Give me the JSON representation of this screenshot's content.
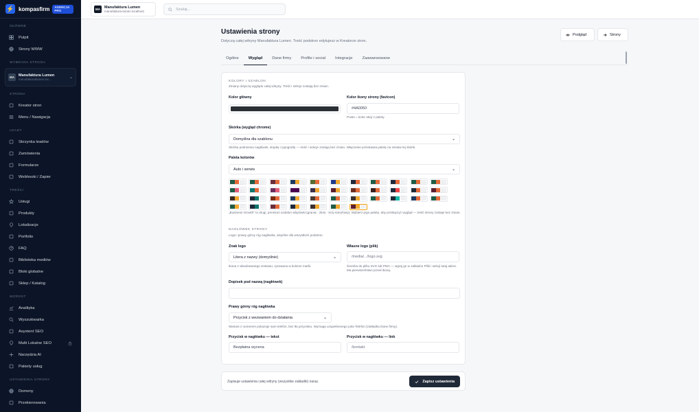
{
  "brand": {
    "name": "kompasfirm",
    "badge": "AGENCJA PRO",
    "logo_glyph": "⚡"
  },
  "sidebar": {
    "sections": [
      {
        "title": "GŁÓWNE",
        "items": [
          {
            "label": "Pulpit",
            "icon": "grid-icon"
          },
          {
            "label": "Strony WWW",
            "icon": "globe-icon"
          }
        ]
      },
      {
        "title": "WYBRANA STRONA"
      },
      {
        "title": "STRONA",
        "items": [
          {
            "label": "Kreator stron",
            "icon": "layout-icon"
          },
          {
            "label": "Menu / Nawigacja",
            "icon": "menu-icon"
          }
        ]
      },
      {
        "title": "LEADY",
        "items": [
          {
            "label": "Skrzynka leadów",
            "icon": "inbox-icon"
          },
          {
            "label": "Zamówienia",
            "icon": "cart-icon"
          },
          {
            "label": "Formularze",
            "icon": "form-icon"
          },
          {
            "label": "Webhooki / Zapier",
            "icon": "webhook-icon"
          }
        ]
      },
      {
        "title": "TREŚCI",
        "items": [
          {
            "label": "Usługi",
            "icon": "star-icon"
          },
          {
            "label": "Produkty",
            "icon": "box-icon"
          },
          {
            "label": "Lokalizacje",
            "icon": "map-pin-icon"
          },
          {
            "label": "Portfolio",
            "icon": "image-icon"
          },
          {
            "label": "FAQ",
            "icon": "help-icon"
          },
          {
            "label": "Biblioteka mediów",
            "icon": "folder-icon"
          },
          {
            "label": "Bloki globalne",
            "icon": "layers-icon"
          },
          {
            "label": "Sklep / Katalog",
            "icon": "tag-icon"
          }
        ]
      },
      {
        "title": "WZROST",
        "items": [
          {
            "label": "Analityka",
            "icon": "chart-icon"
          },
          {
            "label": "Wyszukiwarka",
            "icon": "search-icon"
          },
          {
            "label": "Asystent SEO",
            "icon": "seo-icon"
          },
          {
            "label": "Multi Lokalne SEO",
            "icon": "pin-icon",
            "locked": true
          },
          {
            "label": "Narzędzia AI",
            "icon": "sparkle-icon"
          },
          {
            "label": "Pakiety usług",
            "icon": "package-icon"
          }
        ]
      },
      {
        "title": "USTAWIENIA STRONY",
        "items": [
          {
            "label": "Domeny",
            "icon": "globe-icon"
          },
          {
            "label": "Przekierowania",
            "icon": "redirect-icon"
          }
        ]
      }
    ],
    "site": {
      "initials": "MA",
      "name": "Manufaktura Lumen",
      "url": "manufakturalumen.loc..."
    }
  },
  "topbar": {
    "site_initials": "MA",
    "site_name": "Manufaktura Lumen",
    "site_url": "manufaktura-lumen.localhost",
    "search_placeholder": "Szukaj..."
  },
  "page": {
    "title": "Ustawienia strony",
    "subtitle": "Dotyczą całej witryny Manufaktura Lumen. Treść podstron edytujesz w Kreatorze stron.",
    "preview_label": "Podgląd",
    "pages_label": "Strony",
    "tabs": [
      "Ogólne",
      "Wygląd",
      "Dane firmy",
      "Profile i social",
      "Integracje",
      "Zaawansowane"
    ],
    "active_tab": "Wygląd"
  },
  "form": {
    "colors_caption": "KOLORY I SZABLON",
    "colors_note": "Zmiany dotyczą wyglądu całej witryny. Treść i sekcje zostają bez zmian.",
    "main_color_label": "Kolor główny",
    "main_color_value": "#2b2f36",
    "favicon_label": "Kolor ikony strony (favicon)",
    "favicon_value": "#4A0050",
    "favicon_note": "Puste = kolor akcji z palety.",
    "skin_label": "Skórka (wygląd chrome)",
    "skin_value": "Domyślna dla szablonu",
    "skin_note": "Skórka podmienia nagłówek, stopkę i typografię — treść i sekcje zostają bez zmian. Włączenie przestawia paletę na zestaw tej skórki.",
    "palette_label": "Paleta kolorów",
    "palette_value": "Auto i serwis",
    "palette_note": "„Business Growth” to drugi, premium szablon wbytówki (granat · złoto · krój szeryfowy). Wybierz jego paletę, aby przełączyć wygląd — treść strony zostaje bez zmian.",
    "header_caption": "NAGŁÓWEK STRONY",
    "header_note": "Logo i prawy górny róg nagłówka, wspólne dla wszystkich podstron.",
    "logo_mark_label": "Znak logo",
    "logo_mark_value": "Litera z nazwy (domyślnie)",
    "logo_mark_note": "Ikona z wbudowanego zestawu, rysowana w kolorze marki.",
    "custom_logo_label": "Własne logo (plik)",
    "custom_logo_placeholder": "/media/.../logo.svg",
    "custom_logo_note": "Ścieżka do pliku SVG lub PNG — wgraj go w zakładce Pliki i sekcji tutaj adres. Ma pierwszeństwo przed ikoną.",
    "tagline_label": "Dopisek pod nazwą (nagłówek)",
    "tagline_value": "",
    "corner_label": "Prawy górny róg nagłówka",
    "corner_value": "Przycisk z wezwaniem do działania",
    "corner_note": "Wariant z numerem pokazuje sam telefon, bez tła przycisku. Wymaga uzupełnionego pola Telefon (zakładka Dane firmy).",
    "cta_text_label": "Przycisk w nagłówku — tekst",
    "cta_text_value": "Bezpłatna wycena",
    "cta_link_label": "Przycisk w nagłówku — link",
    "cta_link_placeholder": "/kontakt"
  },
  "palettes": [
    [
      "#1f5c45",
      "#e36b3a"
    ],
    [
      "#1f5c45",
      "#e36b3a"
    ],
    [
      "#6b2d3a",
      "#e36b3a"
    ],
    [
      "#1e3a5f",
      "#f0a830"
    ],
    [
      "#556b2f",
      "#e36b3a"
    ],
    [
      "#1e3a8a",
      "#f0a830"
    ],
    [
      "#1e293b",
      "#e36b3a"
    ],
    [
      "#1f5c45",
      "#e36b3a"
    ],
    [
      "#1e293b",
      "#e36b3a"
    ],
    [
      "#1f5c45",
      "#e36b3a"
    ],
    [
      "#1f5c45",
      "#e36b3a"
    ],
    [
      "#1f5c45",
      "#e25d7a"
    ],
    [
      "#0f766e",
      "#e36b3a"
    ],
    [
      "#6b2d5a",
      "#e25d7a"
    ],
    [
      "#4a0050",
      "#4a0050"
    ],
    [
      "#3b2f4a",
      "#f0a830"
    ],
    [
      "#5b1f2f",
      "#f0a830"
    ],
    [
      "#6b2d1f",
      "#e36b3a"
    ],
    [
      "#3b1f1f",
      "#e36b3a"
    ],
    [
      "#1e293b",
      "#ef4444"
    ],
    [
      "#1f2937",
      "#e36b3a"
    ],
    [
      "#5b1f2f",
      "#e36b3a"
    ],
    [
      "#3b2a1f",
      "#f0a830"
    ],
    [
      "#1f2937",
      "#0f766e"
    ],
    [
      "#7c2d12",
      "#e36b3a"
    ],
    [
      "#1e3a5f",
      "#f0a830"
    ],
    [
      "#4b3b2f",
      "#e36b3a"
    ],
    [
      "#1f5c45",
      "#e36b3a"
    ],
    [
      "#3b2f2f",
      "#f0a830"
    ],
    [
      "#1f5c45",
      "#e36b3a"
    ],
    [
      "#1f2937",
      "#14b8a6"
    ],
    [
      "#1e3a5f",
      "#e36b3a"
    ],
    [
      "#1f5c45",
      "#e36b3a"
    ],
    [
      "#1f5c45",
      "#f0a830"
    ],
    [
      "#1f2937",
      "#0f766e"
    ],
    [
      "#6b2d3a",
      "#e36b3a"
    ],
    [
      "#1e293b",
      "#f0a830"
    ],
    [
      "#3b2f2f",
      "#f0a830"
    ],
    [
      "#1f5c45",
      "#f0a830"
    ],
    [
      "#5b1f2f",
      "#f0a830"
    ]
  ],
  "selected_palette_index": 39,
  "footer": {
    "text": "Zapisuje ustawienia całej witryny (wszystkie zakładki) naraz.",
    "save_label": "Zapisz ustawienia"
  }
}
